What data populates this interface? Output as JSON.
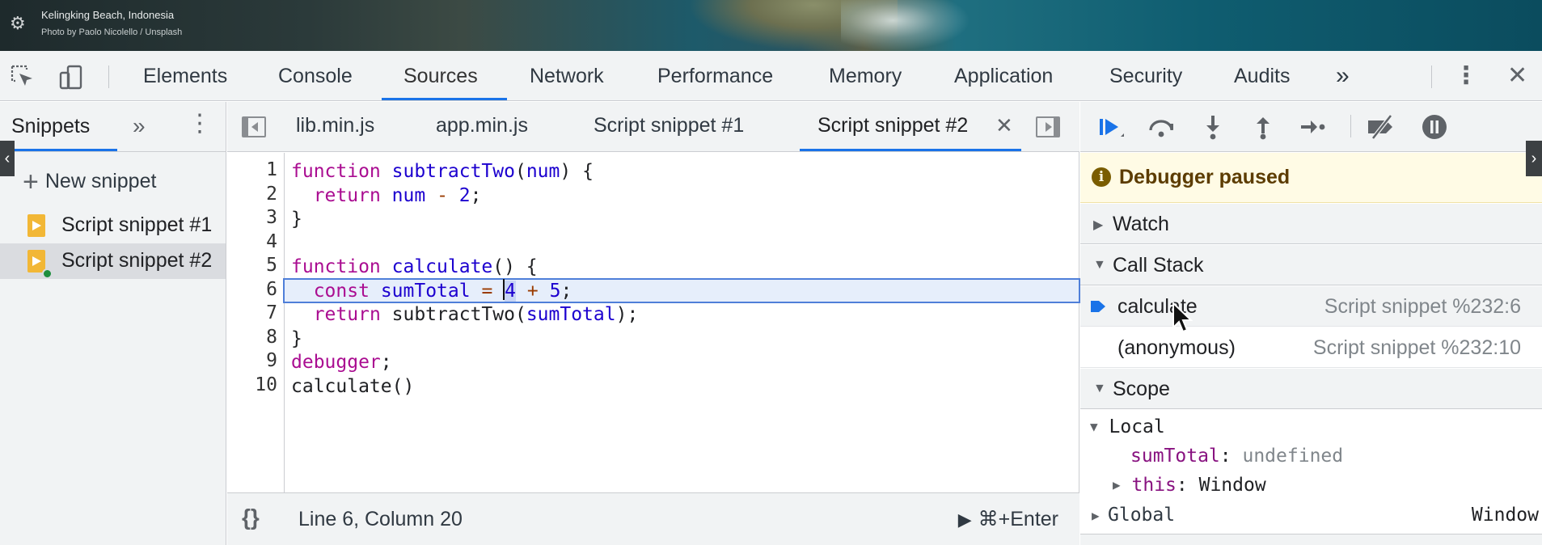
{
  "wallpaper": {
    "location": "Kelingking Beach, Indonesia",
    "credit": "Photo by Paolo Nicolello / Unsplash",
    "settings_icon": "gear-icon"
  },
  "main_toolbar": {
    "tabs": [
      {
        "label": "Elements"
      },
      {
        "label": "Console"
      },
      {
        "label": "Sources",
        "active": true
      },
      {
        "label": "Network"
      },
      {
        "label": "Performance"
      },
      {
        "label": "Memory"
      },
      {
        "label": "Application"
      },
      {
        "label": "Security"
      },
      {
        "label": "Audits"
      }
    ],
    "more_tabs": "»",
    "close": "✕",
    "accent": "#1a73e8"
  },
  "navigator": {
    "tab_label": "Snippets",
    "more": "»",
    "menu": "⋮",
    "new_snippet_label": "New snippet",
    "snippets": [
      {
        "label": "Script snippet #1"
      },
      {
        "label": "Script snippet #2",
        "selected": true,
        "has_breakpoint_dot": true
      }
    ]
  },
  "editor": {
    "tabs": [
      {
        "label": "lib.min.js"
      },
      {
        "label": "app.min.js"
      },
      {
        "label": "Script snippet #1"
      },
      {
        "label": "Script snippet #2",
        "active": true
      }
    ],
    "close_tab": "✕",
    "line_numbers": [
      "1",
      "2",
      "3",
      "4",
      "5",
      "6",
      "7",
      "8",
      "9",
      "10"
    ],
    "execution_line": 6,
    "status": {
      "pretty_print": "{}",
      "cursor_position": "Line 6, Column 20",
      "run_shortcut": "⌘+Enter"
    }
  },
  "debugger": {
    "paused_message": "Debugger paused",
    "sections": {
      "watch": "Watch",
      "call_stack": "Call Stack",
      "scope": "Scope"
    },
    "call_stack": [
      {
        "name": "calculate",
        "location": "Script snippet %232:6",
        "current": true
      },
      {
        "name": "(anonymous)",
        "location": "Script snippet %232:10"
      }
    ],
    "scope": {
      "local_label": "Local",
      "vars": [
        {
          "name": "sumTotal",
          "sep": ": ",
          "value": "undefined"
        },
        {
          "name": "this",
          "sep": ": ",
          "value": "Window"
        }
      ],
      "global_label": "Global",
      "global_value": "Window"
    }
  }
}
